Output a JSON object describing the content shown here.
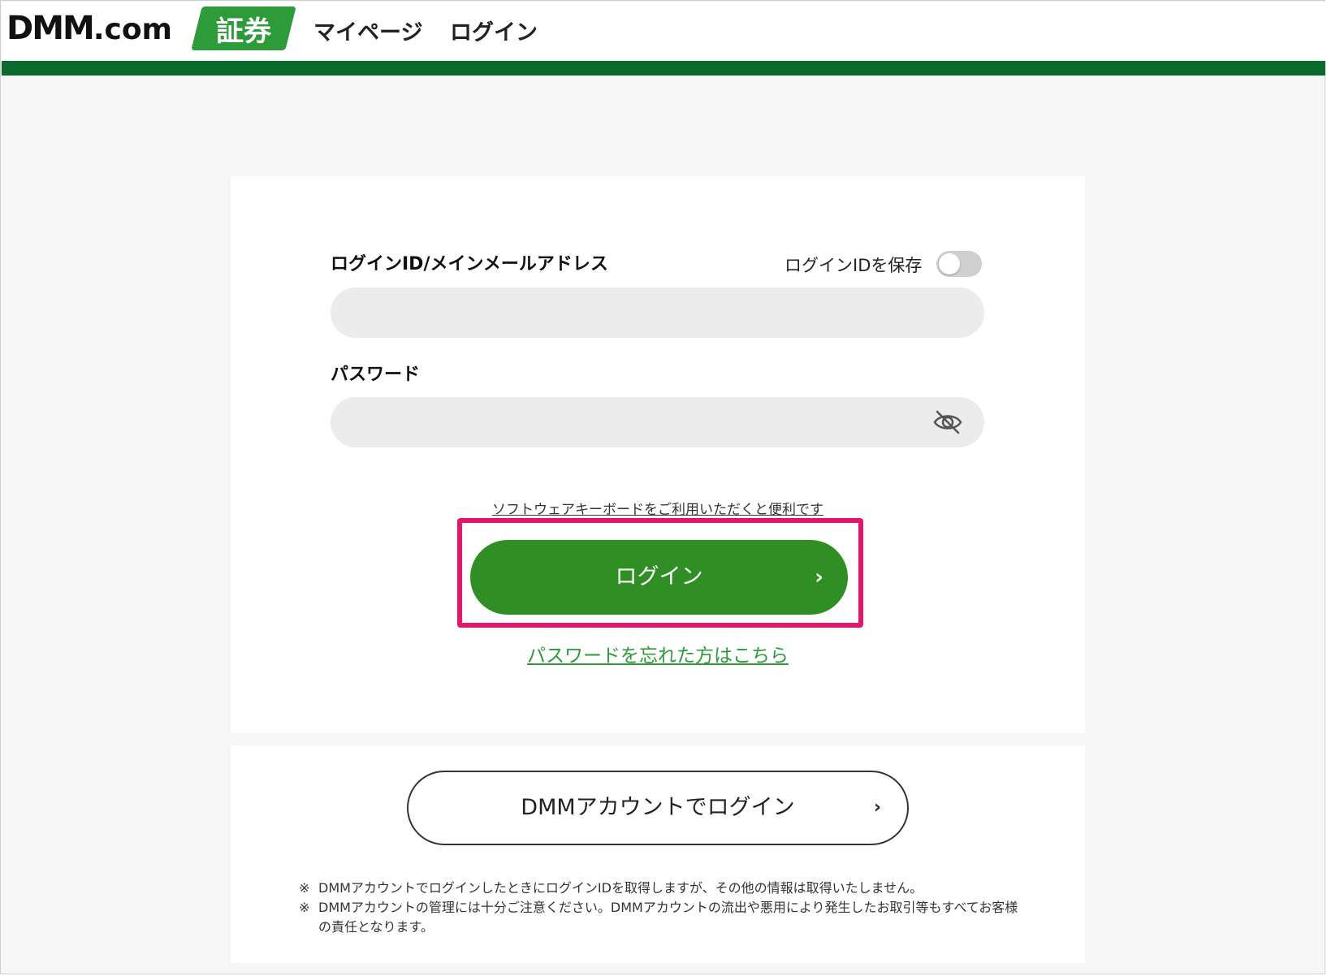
{
  "header": {
    "logo_text": "DMM",
    "logo_com": ".com",
    "logo_badge": "証券",
    "nav": [
      {
        "label": "マイページ"
      },
      {
        "label": "ログイン"
      }
    ]
  },
  "form": {
    "id_label": "ログインID/メインメールアドレス",
    "save_label": "ログインIDを保存",
    "save_toggle_on": false,
    "id_value": "",
    "password_label": "パスワード",
    "password_value": "",
    "keyboard_link": "ソフトウェアキーボードをご利用いただくと便利です",
    "login_button": "ログイン",
    "login_arrow": "›",
    "forgot_link": "パスワードを忘れた方はこちら"
  },
  "dmm": {
    "button_label": "DMMアカウントでログイン",
    "button_arrow": "›",
    "notes": [
      {
        "mark": "※",
        "text": "DMMアカウントでログインしたときにログインIDを取得しますが、その他の情報は取得いたしません。"
      },
      {
        "mark": "※",
        "text": "DMMアカウントの管理には十分ご注意ください。DMMアカウントの流出や悪用により発生したお取引等もすべてお客様の責任となります。"
      }
    ]
  },
  "colors": {
    "brand_green": "#2e9b3a",
    "header_bar": "#0b6b2e",
    "login_button": "#2f8f24",
    "highlight": "#e5156b"
  }
}
